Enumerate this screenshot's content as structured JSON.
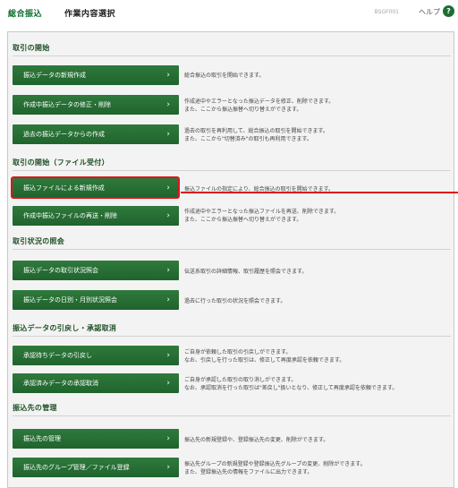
{
  "header": {
    "app_title": "総合振込",
    "screen_title": "作業内容選択",
    "screen_id": "BSGF001",
    "help_label": "ヘルプ",
    "help_icon": "?"
  },
  "chevron": "›",
  "sections": [
    {
      "title": "取引の開始",
      "items": [
        {
          "label": "振込データの新規作成",
          "desc": [
            "総合振込の取引を開始できます。"
          ]
        },
        {
          "label": "作成中振込データの修正・削除",
          "desc": [
            "作成途中やエラーとなった振込データを修正、削除できます。",
            "また、ここから振込振替へ切り替えができます。"
          ]
        },
        {
          "label": "過去の振込データからの作成",
          "desc": [
            "過去の取引を再利用して、総合振込の取引を開始できます。",
            "また、ここから\"切替済み\"の取引も再利用できます。"
          ]
        }
      ]
    },
    {
      "title": "取引の開始（ファイル受付）",
      "items": [
        {
          "label": "振込ファイルによる新規作成",
          "desc": [
            "振込ファイルの指定により、総合振込の取引を開始できます。"
          ]
        },
        {
          "label": "作成中振込ファイルの再送・削除",
          "desc": [
            "作成途中やエラーとなった振込ファイルを再送、削除できます。",
            "また、ここから振込振替へ切り替えができます。"
          ]
        }
      ]
    },
    {
      "title": "取引状況の照会",
      "items": [
        {
          "label": "振込データの取引状況照会",
          "desc": [
            "伝送系取引の詳細情報、取引履歴を照会できます。"
          ]
        },
        {
          "label": "振込データの日別・月別状況照会",
          "desc": [
            "過去に行った取引の状況を照会できます。"
          ]
        }
      ]
    },
    {
      "title": "振込データの引戻し・承認取消",
      "items": [
        {
          "label": "承認待ちデータの引戻し",
          "desc": [
            "ご自身が依頼した取引の引戻しができます。",
            "なお、引戻しを行った取引は、修正して再度承認を依頼できます。"
          ]
        },
        {
          "label": "承認済みデータの承認取消",
          "desc": [
            "ご自身が承認した取引の取り消しができます。",
            "なお、承認取消を行った取引は\"差戻し\"扱いとなり、修正して再度承認を依頼できます。"
          ]
        }
      ]
    },
    {
      "title": "振込先の管理",
      "items": [
        {
          "label": "振込先の管理",
          "desc": [
            "振込先の新規登録や、登録振込先の変更、削除ができます。"
          ]
        },
        {
          "label": "振込先のグループ管理／ファイル登録",
          "desc": [
            "振込先グループの新規登録や登録振込先グループの変更、削除ができます。",
            "また、登録振込先の情報をファイルに出力できます。"
          ]
        }
      ]
    }
  ]
}
